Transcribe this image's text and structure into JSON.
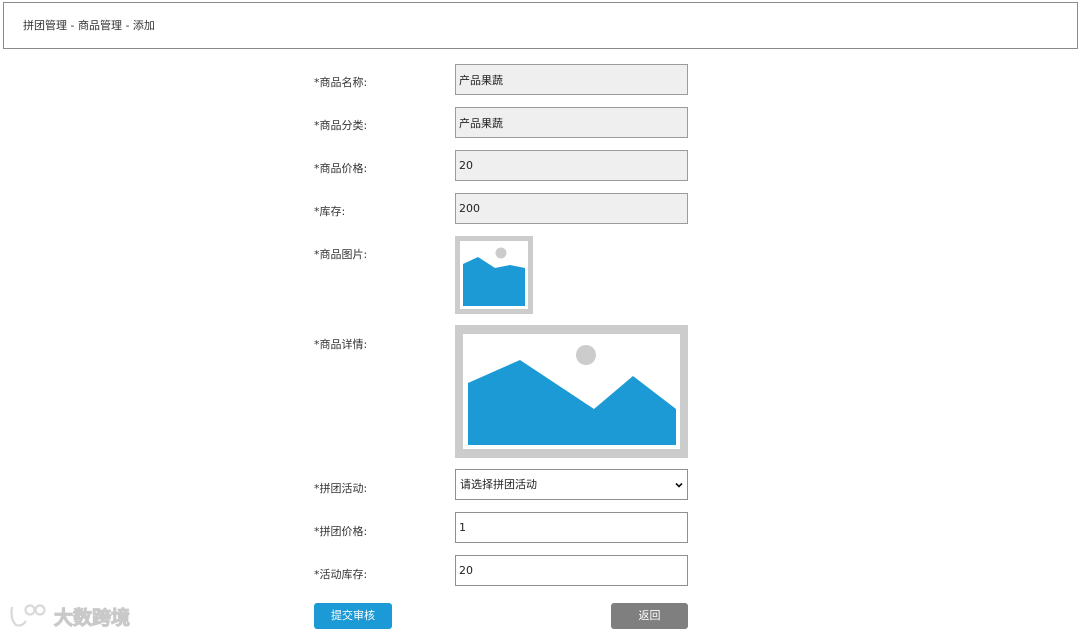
{
  "breadcrumb": "拼团管理 - 商品管理 - 添加",
  "form": {
    "product_name": {
      "label": "*商品名称:",
      "value": "产品果蔬"
    },
    "product_category": {
      "label": "*商品分类:",
      "value": "产品果蔬"
    },
    "product_price": {
      "label": "*商品价格:",
      "value": "20"
    },
    "stock": {
      "label": "*库存:",
      "value": "200"
    },
    "product_image": {
      "label": "*商品图片:"
    },
    "product_detail": {
      "label": "*商品详情:"
    },
    "group_activity": {
      "label": "*拼团活动:",
      "selected": "请选择拼团活动"
    },
    "group_price": {
      "label": "*拼团价格:",
      "value": "1"
    },
    "activity_stock": {
      "label": "*活动库存:",
      "value": "20"
    }
  },
  "buttons": {
    "submit": "提交审核",
    "back": "返回"
  },
  "watermark": {
    "text": "大数跨境"
  },
  "colors": {
    "accent": "#1b9ad6",
    "image_placeholder_blue": "#1b9ad6",
    "image_placeholder_frame": "#cccccc",
    "back_button": "#7f7f7f"
  },
  "icons": {
    "image_placeholder": "image-placeholder-icon",
    "select_arrow": "chevron-down-icon"
  }
}
